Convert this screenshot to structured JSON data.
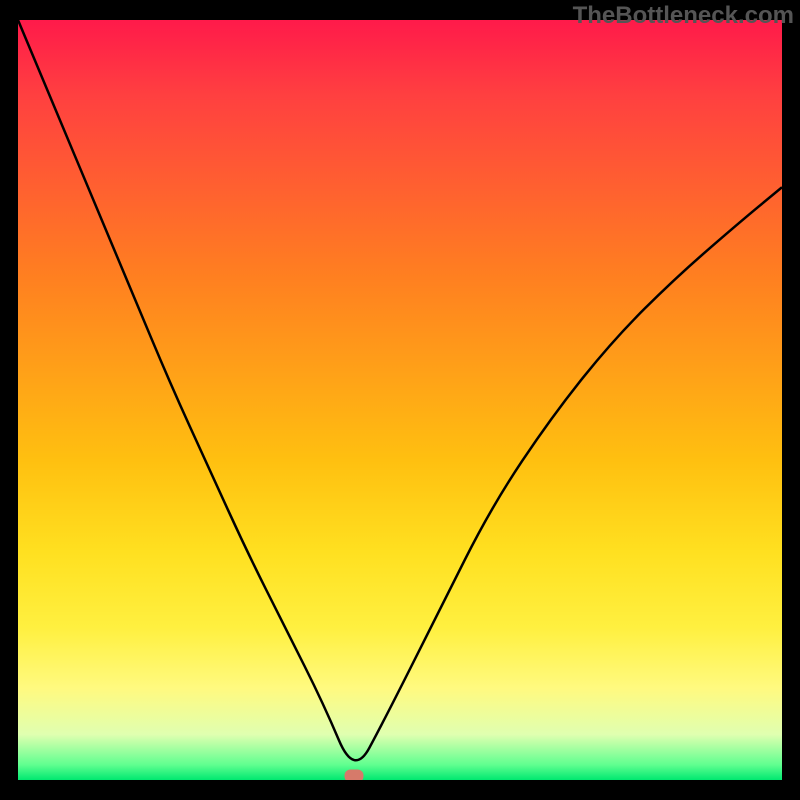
{
  "watermark": "TheBottleneck.com",
  "chart_data": {
    "type": "line",
    "title": "",
    "xlabel": "",
    "ylabel": "",
    "xlim": [
      0,
      100
    ],
    "ylim": [
      0,
      100
    ],
    "marker": {
      "x": 44,
      "y": 0.5
    },
    "series": [
      {
        "name": "curve",
        "x": [
          0,
          5,
          10,
          15,
          20,
          25,
          30,
          35,
          40,
          44,
          48,
          55,
          62,
          70,
          78,
          86,
          94,
          100
        ],
        "values": [
          100,
          88,
          76,
          64,
          52,
          41,
          30,
          20,
          10,
          0.5,
          8,
          22,
          36,
          48,
          58,
          66,
          73,
          78
        ]
      }
    ]
  }
}
